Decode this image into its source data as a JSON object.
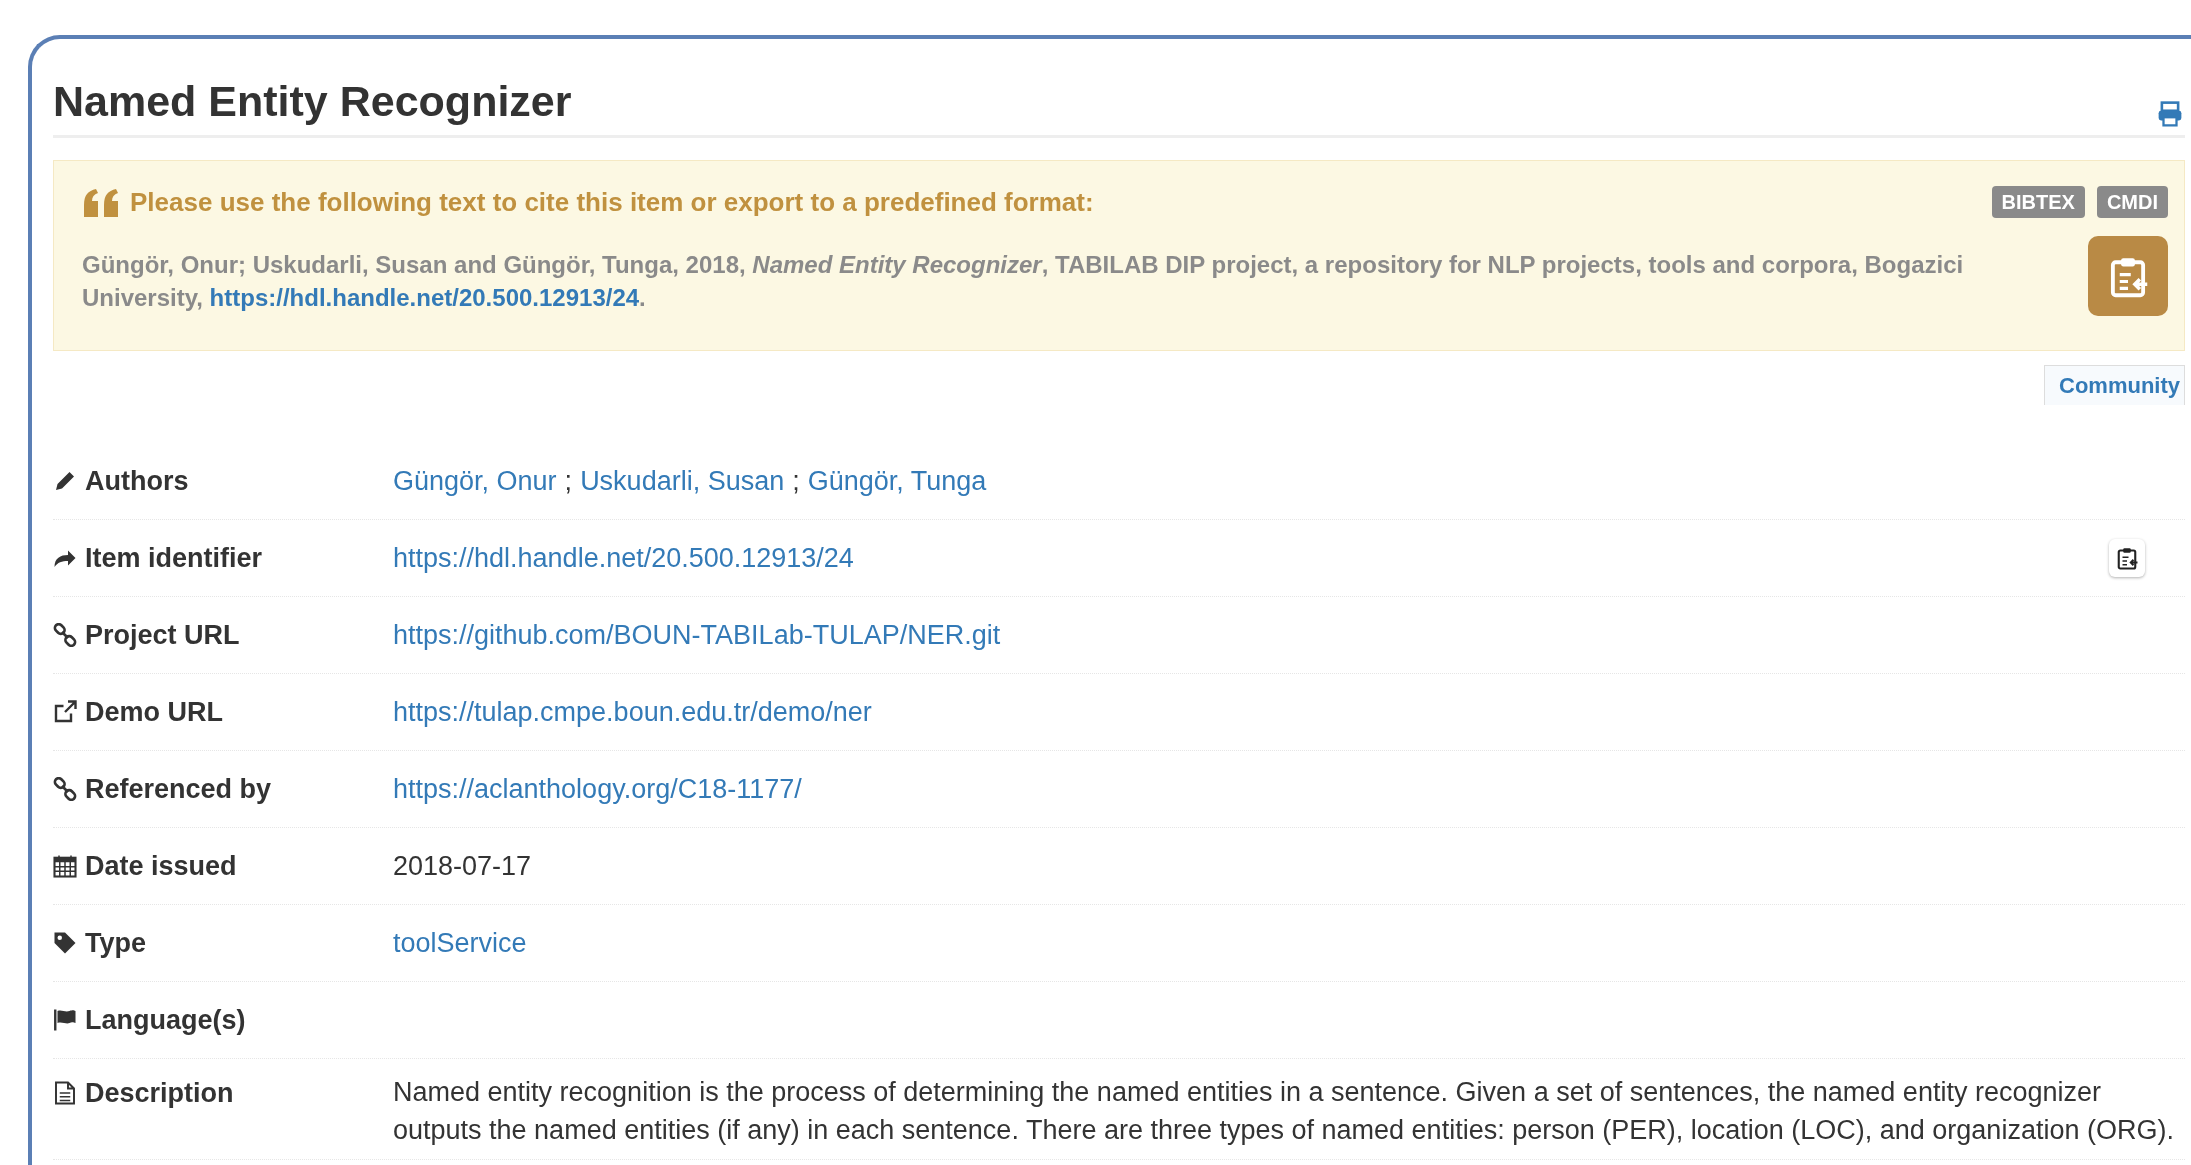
{
  "title": "Named Entity Recognizer",
  "citation": {
    "heading": "Please use the following text to cite this item or export to a predefined format:",
    "formats": [
      "BIBTEX",
      "CMDI"
    ],
    "text": "Güngör, Onur; Uskudarli, Susan and Güngör, Tunga, 2018, *Named Entity Recognizer*, TABILAB DIP project, a repository for NLP projects, tools and corpora, Bogazici University, ",
    "link": "https://hdl.handle.net/20.500.12913/24",
    "after": "."
  },
  "community_tab": {
    "label": "Community"
  },
  "fields": [
    {
      "label": "Authors",
      "copy_button": false,
      "value": [
        {
          "kind": "link",
          "text": "Güngör, Onur"
        },
        {
          "kind": "text",
          "text": ";"
        },
        {
          "kind": "link",
          "text": "Uskudarli, Susan"
        },
        {
          "kind": "text",
          "text": ";"
        },
        {
          "kind": "link",
          "text": "Güngör, Tunga"
        }
      ]
    },
    {
      "label": "Item identifier",
      "copy_button": true,
      "value": [
        {
          "kind": "link",
          "text": "https://hdl.handle.net/20.500.12913/24"
        }
      ]
    },
    {
      "label": "Project URL",
      "copy_button": false,
      "value": [
        {
          "kind": "link",
          "text": "https://github.com/BOUN-TABILab-TULAP/NER.git"
        }
      ]
    },
    {
      "label": "Demo URL",
      "copy_button": false,
      "value": [
        {
          "kind": "link",
          "text": "https://tulap.cmpe.boun.edu.tr/demo/ner"
        }
      ]
    },
    {
      "label": "Referenced by",
      "copy_button": false,
      "value": [
        {
          "kind": "link",
          "text": "https://aclanthology.org/C18-1177/"
        }
      ]
    },
    {
      "label": "Date issued",
      "copy_button": false,
      "value": [
        {
          "kind": "text",
          "text": "2018-07-17"
        }
      ]
    },
    {
      "label": "Type",
      "copy_button": false,
      "value": [
        {
          "kind": "link",
          "text": "toolService"
        }
      ]
    },
    {
      "label": "Language(s)",
      "copy_button": false
    },
    {
      "label": "Description",
      "copy_button": false,
      "value": [
        {
          "kind": "text",
          "text": "Named entity recognition is the process of determining the named entities in a sentence. Given a set of sentences, the named entity recognizer outputs the named entities (if any) in each sentence. There are three types of named entities: person (PER), location (LOC), and organization (ORG)."
        }
      ]
    }
  ]
}
